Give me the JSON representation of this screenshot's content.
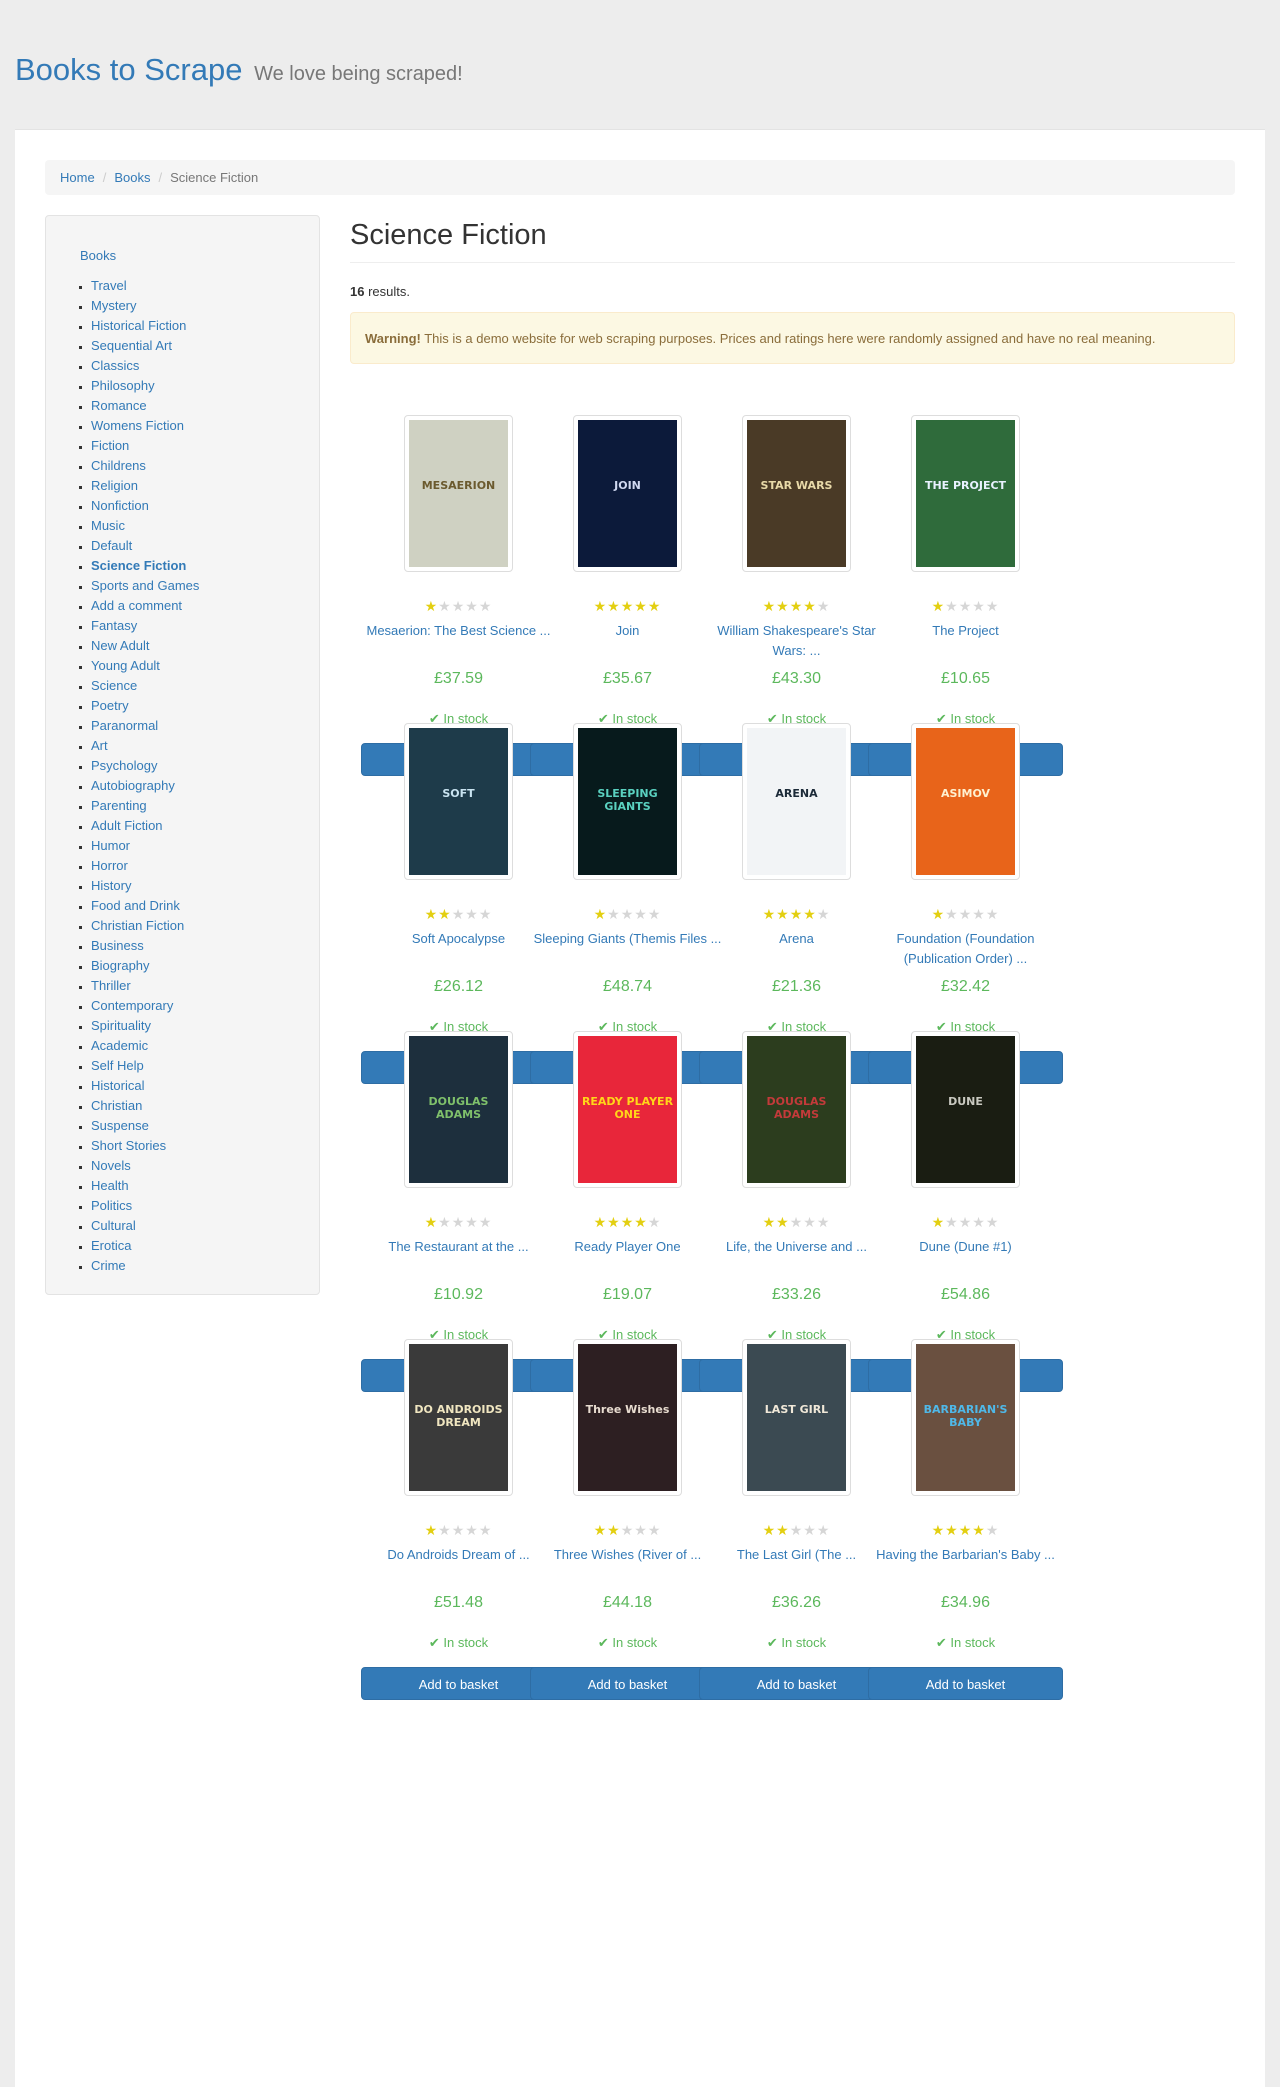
{
  "header": {
    "brand": "Books to Scrape",
    "tagline": "We love being scraped!"
  },
  "breadcrumb": {
    "home": "Home",
    "books": "Books",
    "current": "Science Fiction"
  },
  "sidebar": {
    "root": "Books",
    "categories": [
      "Travel",
      "Mystery",
      "Historical Fiction",
      "Sequential Art",
      "Classics",
      "Philosophy",
      "Romance",
      "Womens Fiction",
      "Fiction",
      "Childrens",
      "Religion",
      "Nonfiction",
      "Music",
      "Default",
      "Science Fiction",
      "Sports and Games",
      "Add a comment",
      "Fantasy",
      "New Adult",
      "Young Adult",
      "Science",
      "Poetry",
      "Paranormal",
      "Art",
      "Psychology",
      "Autobiography",
      "Parenting",
      "Adult Fiction",
      "Humor",
      "Horror",
      "History",
      "Food and Drink",
      "Christian Fiction",
      "Business",
      "Biography",
      "Thriller",
      "Contemporary",
      "Spirituality",
      "Academic",
      "Self Help",
      "Historical",
      "Christian",
      "Suspense",
      "Short Stories",
      "Novels",
      "Health",
      "Politics",
      "Cultural",
      "Erotica",
      "Crime"
    ],
    "current": "Science Fiction"
  },
  "main": {
    "title": "Science Fiction",
    "results_count": "16",
    "results_suffix": " results.",
    "warning_label": "Warning!",
    "warning_text": " This is a demo website for web scraping purposes. Prices and ratings here were randomly assigned and have no real meaning."
  },
  "product_labels": {
    "in_stock": "In stock",
    "add_to_basket": "Add to basket"
  },
  "products": [
    {
      "title": "Mesaerion: The Best Science ...",
      "price": "£37.59",
      "rating": 1,
      "cover_bg": "#cfd1c2",
      "cover_fg": "#6b5a2e",
      "cover_text": "MESAERION"
    },
    {
      "title": "Join",
      "price": "£35.67",
      "rating": 5,
      "cover_bg": "#0c1a3a",
      "cover_fg": "#d0d8f0",
      "cover_text": "JOIN"
    },
    {
      "title": "William Shakespeare's Star Wars: ...",
      "price": "£43.30",
      "rating": 4,
      "cover_bg": "#4a3a26",
      "cover_fg": "#e8d9a8",
      "cover_text": "STAR WARS"
    },
    {
      "title": "The Project",
      "price": "£10.65",
      "rating": 1,
      "cover_bg": "#2f6b3b",
      "cover_fg": "#e9f2ff",
      "cover_text": "THE PROJECT"
    },
    {
      "title": "Soft Apocalypse",
      "price": "£26.12",
      "rating": 2,
      "cover_bg": "#1e3b4a",
      "cover_fg": "#c9e3f0",
      "cover_text": "SOFT"
    },
    {
      "title": "Sleeping Giants (Themis Files ...",
      "price": "£48.74",
      "rating": 1,
      "cover_bg": "#071a1c",
      "cover_fg": "#5ad1c0",
      "cover_text": "SLEEPING GIANTS"
    },
    {
      "title": "Arena",
      "price": "£21.36",
      "rating": 4,
      "cover_bg": "#f2f4f6",
      "cover_fg": "#1c2a38",
      "cover_text": "ARENA"
    },
    {
      "title": "Foundation (Foundation (Publication Order) ...",
      "price": "£32.42",
      "rating": 1,
      "cover_bg": "#e8641a",
      "cover_fg": "#fff1d0",
      "cover_text": "ASIMOV"
    },
    {
      "title": "The Restaurant at the ...",
      "price": "£10.92",
      "rating": 1,
      "cover_bg": "#1d2f3d",
      "cover_fg": "#7fc06b",
      "cover_text": "DOUGLAS ADAMS"
    },
    {
      "title": "Ready Player One",
      "price": "£19.07",
      "rating": 4,
      "cover_bg": "#e8263a",
      "cover_fg": "#ffd619",
      "cover_text": "READY PLAYER ONE"
    },
    {
      "title": "Life, the Universe and ...",
      "price": "£33.26",
      "rating": 2,
      "cover_bg": "#2c3d1e",
      "cover_fg": "#c33a3a",
      "cover_text": "DOUGLAS ADAMS"
    },
    {
      "title": "Dune (Dune #1)",
      "price": "£54.86",
      "rating": 1,
      "cover_bg": "#1a1d12",
      "cover_fg": "#c9c9c0",
      "cover_text": "DUNE"
    },
    {
      "title": "Do Androids Dream of ...",
      "price": "£51.48",
      "rating": 1,
      "cover_bg": "#3a3a3a",
      "cover_fg": "#f0e6c0",
      "cover_text": "DO ANDROIDS DREAM"
    },
    {
      "title": "Three Wishes (River of ...",
      "price": "£44.18",
      "rating": 2,
      "cover_bg": "#2d1f22",
      "cover_fg": "#e8dcd0",
      "cover_text": "Three Wishes"
    },
    {
      "title": "The Last Girl (The ...",
      "price": "£36.26",
      "rating": 2,
      "cover_bg": "#3b4a52",
      "cover_fg": "#f0e8d8",
      "cover_text": "LAST GIRL"
    },
    {
      "title": "Having the Barbarian's Baby ...",
      "price": "£34.96",
      "rating": 4,
      "cover_bg": "#6a5040",
      "cover_fg": "#4fb8e8",
      "cover_text": "BARBARIAN'S BABY"
    }
  ]
}
